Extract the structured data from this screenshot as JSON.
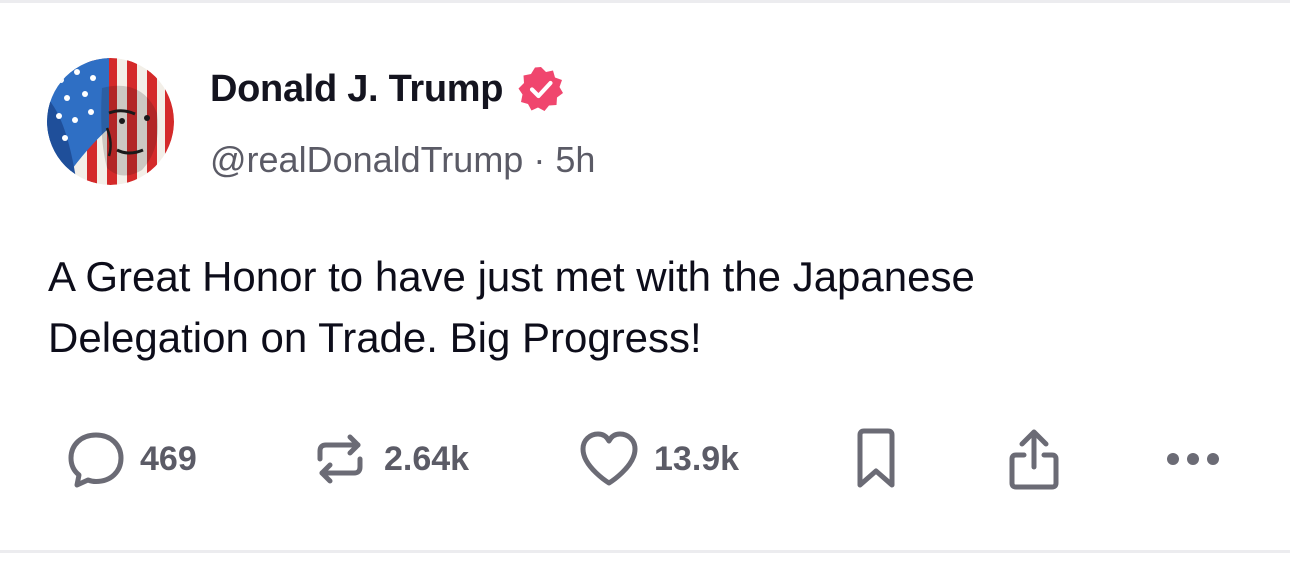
{
  "post": {
    "author": {
      "display_name": "Donald J. Trump",
      "handle": "@realDonaldTrump",
      "verified": true,
      "verified_color": "#f0466e"
    },
    "separator": "·",
    "time_ago": "5h",
    "text_lines": [
      "A Great Honor to have just met with the Japanese",
      "Delegation on Trade. Big Progress!"
    ]
  },
  "actions": {
    "replies": {
      "icon": "comment-icon",
      "count": "469"
    },
    "reposts": {
      "icon": "repost-icon",
      "count": "2.64k"
    },
    "likes": {
      "icon": "heart-icon",
      "count": "13.9k"
    },
    "bookmark": {
      "icon": "bookmark-icon"
    },
    "share": {
      "icon": "share-icon"
    },
    "more": {
      "icon": "more-horizontal-icon"
    }
  },
  "colors": {
    "text": "#0d0d1a",
    "muted": "#5b5b66",
    "icon": "#6b6b75",
    "divider": "#ececef"
  }
}
